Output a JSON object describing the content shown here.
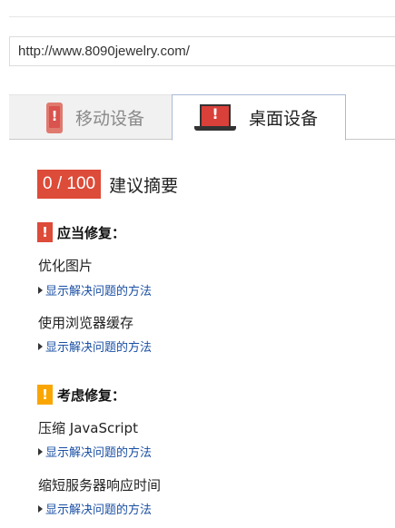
{
  "url_bar": {
    "value": "http://www.8090jewelry.com/"
  },
  "tabs": {
    "mobile_label": "移动设备",
    "desktop_label": "桌面设备"
  },
  "score": {
    "value": "0 / 100",
    "caption": "建议摘要"
  },
  "sections": [
    {
      "title": "应当修复：",
      "icon": "!",
      "color": "#dd4b39",
      "rules": [
        {
          "name": "优化图片",
          "link": "显示解决问题的方法"
        },
        {
          "name": "使用浏览器缓存",
          "link": "显示解决问题的方法"
        }
      ]
    },
    {
      "title": "考虑修复：",
      "icon": "!",
      "color": "#f9a602",
      "rules": [
        {
          "name": "压缩 JavaScript",
          "link": "显示解决问题的方法"
        },
        {
          "name": "缩短服务器响应时间",
          "link": "显示解决问题的方法"
        }
      ]
    }
  ]
}
